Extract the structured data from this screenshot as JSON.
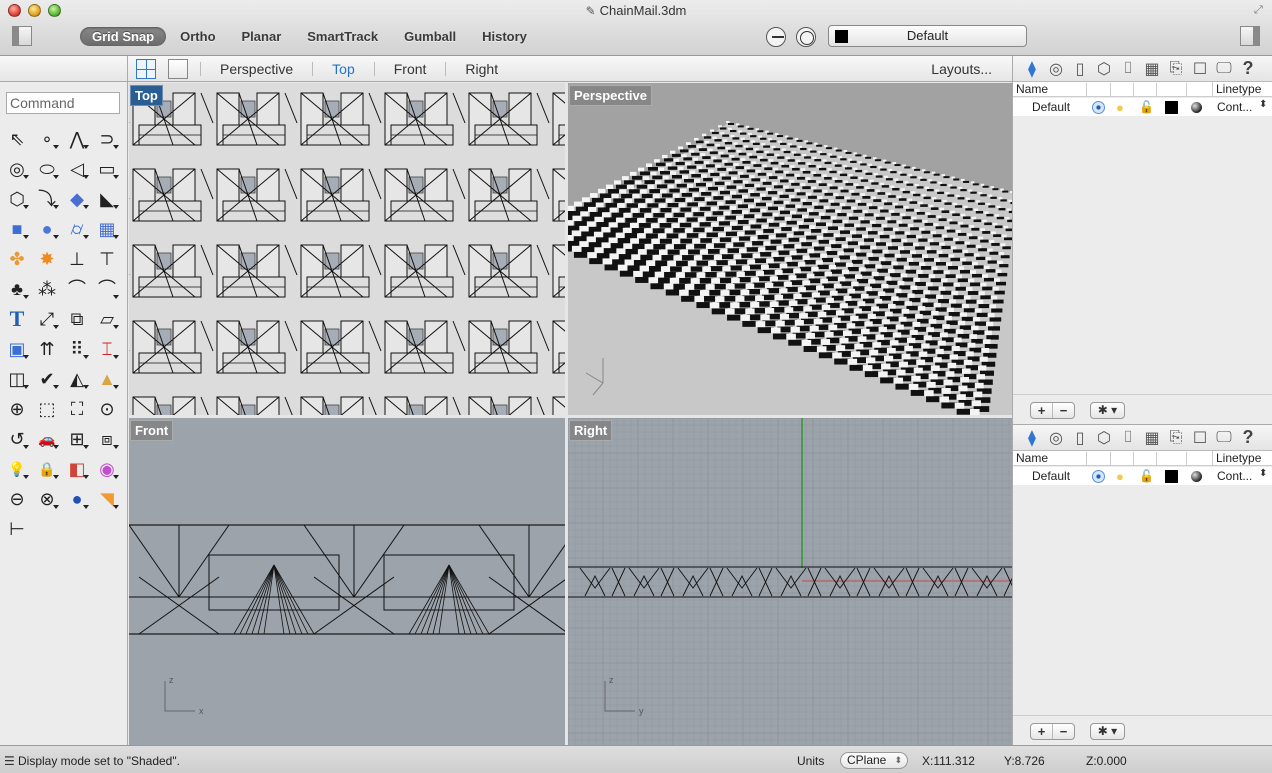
{
  "window": {
    "title": "ChainMail.3dm",
    "doc_icon": "rhino-document-icon"
  },
  "toolbar": {
    "modes": [
      {
        "label": "Grid Snap",
        "active": true
      },
      {
        "label": "Ortho",
        "active": false
      },
      {
        "label": "Planar",
        "active": false
      },
      {
        "label": "SmartTrack",
        "active": false
      },
      {
        "label": "Gumball",
        "active": false
      },
      {
        "label": "History",
        "active": false
      }
    ],
    "osnap_icon": "osnap-icon",
    "record_icon": "target-icon",
    "layer_select": {
      "value": "Default",
      "swatch_color": "#000000"
    }
  },
  "viewport_tabs": {
    "tabs": [
      {
        "label": "Perspective",
        "active": false
      },
      {
        "label": "Top",
        "active": true
      },
      {
        "label": "Front",
        "active": false
      },
      {
        "label": "Right",
        "active": false
      }
    ],
    "layouts_label": "Layouts...",
    "active_color": "#2472c8"
  },
  "command": {
    "placeholder": "Command",
    "value": ""
  },
  "tools": [
    {
      "name": "select-arrow-icon",
      "glyph": "⇖",
      "dd": false
    },
    {
      "name": "point-icon",
      "glyph": "∘",
      "dd": true
    },
    {
      "name": "polyline-icon",
      "glyph": "⋀",
      "dd": true
    },
    {
      "name": "curve-icon",
      "glyph": "⊃",
      "dd": true
    },
    {
      "name": "circle-icon",
      "glyph": "◎",
      "dd": true
    },
    {
      "name": "ellipse-icon",
      "glyph": "⬭",
      "dd": true
    },
    {
      "name": "arc-icon",
      "glyph": "◁",
      "dd": true
    },
    {
      "name": "rectangle-icon",
      "glyph": "▭",
      "dd": true
    },
    {
      "name": "polygon-icon",
      "glyph": "⬡",
      "dd": true
    },
    {
      "name": "fillet-icon",
      "glyph": "⤵",
      "dd": true
    },
    {
      "name": "surface-icon",
      "glyph": "◆",
      "dd": true
    },
    {
      "name": "extrude-surface-icon",
      "glyph": "◣",
      "dd": true
    },
    {
      "name": "box-icon",
      "glyph": "■",
      "dd": true
    },
    {
      "name": "boolean-spheres-icon",
      "glyph": "●",
      "dd": true
    },
    {
      "name": "cylinder-icon",
      "glyph": "⌭",
      "dd": true
    },
    {
      "name": "mesh-icon",
      "glyph": "▦",
      "dd": true
    },
    {
      "name": "puzzle-icon",
      "glyph": "✤",
      "dd": false
    },
    {
      "name": "explode-icon",
      "glyph": "✸",
      "dd": false
    },
    {
      "name": "trim-icon",
      "glyph": "⊥",
      "dd": false
    },
    {
      "name": "split-icon",
      "glyph": "⊤",
      "dd": false
    },
    {
      "name": "group-icon",
      "glyph": "♣",
      "dd": true
    },
    {
      "name": "ungroup-icon",
      "glyph": "⁂",
      "dd": false
    },
    {
      "name": "edit-points-icon",
      "glyph": "⌒",
      "dd": false
    },
    {
      "name": "offset-curve-icon",
      "glyph": "⌒",
      "dd": true
    },
    {
      "name": "text-icon",
      "glyph": "T",
      "dd": false
    },
    {
      "name": "move-icon",
      "glyph": "⤢",
      "dd": true
    },
    {
      "name": "array-icon",
      "glyph": "⧉",
      "dd": false
    },
    {
      "name": "transform-icon",
      "glyph": "▱",
      "dd": true
    },
    {
      "name": "solid-edit-icon",
      "glyph": "▣",
      "dd": true
    },
    {
      "name": "extrude-up-icon",
      "glyph": "⇈",
      "dd": false
    },
    {
      "name": "grid-array-icon",
      "glyph": "⠿",
      "dd": true
    },
    {
      "name": "section-icon",
      "glyph": "⌶",
      "dd": true
    },
    {
      "name": "dimension-icon",
      "glyph": "◫",
      "dd": true
    },
    {
      "name": "check-icon",
      "glyph": "✔",
      "dd": true
    },
    {
      "name": "shapes-icon",
      "glyph": "◭",
      "dd": true
    },
    {
      "name": "pyramid-icon",
      "glyph": "▲",
      "dd": true
    },
    {
      "name": "zoom-icon",
      "glyph": "⊕",
      "dd": false
    },
    {
      "name": "zoom-window-icon",
      "glyph": "⬚",
      "dd": false
    },
    {
      "name": "zoom-extents-icon",
      "glyph": "⛶",
      "dd": false
    },
    {
      "name": "zoom-selected-icon",
      "glyph": "⊙",
      "dd": false
    },
    {
      "name": "rotate-view-icon",
      "glyph": "↺",
      "dd": true
    },
    {
      "name": "car-icon",
      "glyph": "🚗",
      "dd": true
    },
    {
      "name": "cplane-icon",
      "glyph": "⊞",
      "dd": true
    },
    {
      "name": "named-views-icon",
      "glyph": "⧈",
      "dd": true
    },
    {
      "name": "light-bulb-icon",
      "glyph": "💡",
      "dd": true
    },
    {
      "name": "lock-icon",
      "glyph": "🔒",
      "dd": true
    },
    {
      "name": "layers-icon",
      "glyph": "◧",
      "dd": true
    },
    {
      "name": "color-wheel-icon",
      "glyph": "◉",
      "dd": true
    },
    {
      "name": "wireframe-sphere-icon",
      "glyph": "⊖",
      "dd": false
    },
    {
      "name": "grid-sphere-icon",
      "glyph": "⊗",
      "dd": true
    },
    {
      "name": "render-sphere-icon",
      "glyph": "●",
      "dd": true
    },
    {
      "name": "render-cone-icon",
      "glyph": "◥",
      "dd": true
    },
    {
      "name": "dimension-tree-icon",
      "glyph": "⊢",
      "dd": false
    }
  ],
  "viewports": {
    "top": {
      "label": "Top",
      "active": true
    },
    "perspective": {
      "label": "Perspective",
      "active": false
    },
    "front": {
      "label": "Front",
      "active": false,
      "axes": [
        "z",
        "x"
      ]
    },
    "right": {
      "label": "Right",
      "active": false,
      "axes": [
        "z",
        "y"
      ]
    }
  },
  "right_panel": {
    "sections": [
      {
        "icons": [
          "layers-icon",
          "target-icon",
          "page-icon",
          "cube-icon",
          "camera-icon",
          "cplane-grid-icon",
          "scroll-icon",
          "window-icon",
          "display-icon",
          "help-icon"
        ],
        "columns": {
          "name": "Name",
          "linetype": "Linetype"
        },
        "rows": [
          {
            "name": "Default",
            "current": true,
            "visible": true,
            "locked": false,
            "color": "#000000",
            "linetype": "Cont..."
          }
        ],
        "footer": {
          "add": "+",
          "remove": "−",
          "gear": "✱ ▾"
        }
      },
      {
        "icons": [
          "layers-icon",
          "target-icon",
          "page-icon",
          "cube-icon",
          "camera-icon",
          "cplane-grid-icon",
          "scroll-icon",
          "window-icon",
          "display-icon",
          "help-icon"
        ],
        "columns": {
          "name": "Name",
          "linetype": "Linetype"
        },
        "rows": [
          {
            "name": "Default",
            "current": true,
            "visible": true,
            "locked": false,
            "color": "#000000",
            "linetype": "Cont..."
          }
        ],
        "footer": {
          "add": "+",
          "remove": "−",
          "gear": "✱ ▾"
        }
      }
    ]
  },
  "statusbar": {
    "message": "Display mode set to \"Shaded\".",
    "units_label": "Units",
    "cplane_value": "CPlane",
    "x": "X:111.312",
    "y": "Y:8.726",
    "z": "Z:0.000"
  }
}
